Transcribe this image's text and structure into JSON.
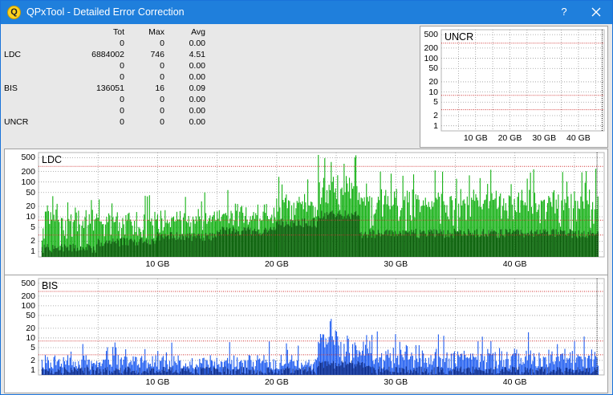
{
  "window": {
    "title": "QPxTool - Detailed Error Correction",
    "app_icon_letter": "Q",
    "help_label": "?",
    "close_icon": "close-icon"
  },
  "stats": {
    "headers": [
      "",
      "Tot",
      "Max",
      "Avg"
    ],
    "rows": [
      {
        "label": "",
        "tot": "0",
        "max": "0",
        "avg": "0.00"
      },
      {
        "label": "LDC",
        "tot": "6884002",
        "max": "746",
        "avg": "4.51"
      },
      {
        "label": "",
        "tot": "0",
        "max": "0",
        "avg": "0.00"
      },
      {
        "label": "",
        "tot": "0",
        "max": "0",
        "avg": "0.00"
      },
      {
        "label": "BIS",
        "tot": "136051",
        "max": "16",
        "avg": "0.09"
      },
      {
        "label": "",
        "tot": "0",
        "max": "0",
        "avg": "0.00"
      },
      {
        "label": "",
        "tot": "0",
        "max": "0",
        "avg": "0.00"
      },
      {
        "label": "UNCR",
        "tot": "0",
        "max": "0",
        "avg": "0.00"
      }
    ]
  },
  "colors": {
    "ldc_bar": "#12b012",
    "ldc_avg": "#0a5a0a",
    "bis_bar": "#1e5cf0",
    "bis_avg": "#0a2a8a",
    "threshold_line": "#d03030",
    "grid": "#9a9a9a"
  },
  "chart_data": [
    {
      "type": "bar",
      "title": "UNCR",
      "y_scale": "log",
      "y_ticks": [
        "500",
        "200",
        "100",
        "50",
        "20",
        "10",
        "5",
        "2",
        "1"
      ],
      "x_ticks": [
        "10 GB",
        "20 GB",
        "30 GB",
        "40 GB"
      ],
      "x_unit": "GB",
      "x_range": [
        0,
        47.5
      ],
      "values_summary": {
        "total": 0,
        "max": 0,
        "avg": 0.0
      },
      "threshold_lines": [
        280,
        8,
        3
      ],
      "end_marker_gb": 46.9
    },
    {
      "type": "bar",
      "title": "LDC",
      "y_scale": "log",
      "y_ticks": [
        "500",
        "200",
        "100",
        "50",
        "20",
        "10",
        "5",
        "2",
        "1"
      ],
      "x_ticks": [
        "10 GB",
        "20 GB",
        "30 GB",
        "40 GB"
      ],
      "x_unit": "GB",
      "x_range": [
        0,
        47.5
      ],
      "values_summary": {
        "total": 6884002,
        "max": 746,
        "avg": 4.51
      },
      "threshold_lines": [
        280,
        8,
        3
      ],
      "end_marker_gb": 46.9,
      "segments": [
        {
          "x_start": 0.3,
          "x_end": 5.0,
          "peak_typical": 15,
          "avg": 1.3
        },
        {
          "x_start": 5.0,
          "x_end": 10.0,
          "peak_typical": 12,
          "avg": 2.0
        },
        {
          "x_start": 10.0,
          "x_end": 15.0,
          "peak_typical": 14,
          "avg": 2.8
        },
        {
          "x_start": 15.0,
          "x_end": 20.0,
          "peak_typical": 20,
          "avg": 4.0
        },
        {
          "x_start": 20.0,
          "x_end": 23.5,
          "peak_typical": 40,
          "avg": 7.0
        },
        {
          "x_start": 23.5,
          "x_end": 27.0,
          "peak_typical": 150,
          "avg": 12.0
        },
        {
          "x_start": 27.0,
          "x_end": 47.0,
          "peak_typical": 60,
          "avg": 3.5
        }
      ]
    },
    {
      "type": "bar",
      "title": "BIS",
      "y_scale": "log",
      "y_ticks": [
        "500",
        "200",
        "100",
        "50",
        "20",
        "10",
        "5",
        "2",
        "1"
      ],
      "x_ticks": [
        "10 GB",
        "20 GB",
        "30 GB",
        "40 GB"
      ],
      "x_unit": "GB",
      "x_range": [
        0,
        47.5
      ],
      "values_summary": {
        "total": 136051,
        "max": 16,
        "avg": 0.09
      },
      "threshold_lines": [
        280,
        8,
        3
      ],
      "end_marker_gb": 46.9,
      "segments": [
        {
          "x_start": 0.3,
          "x_end": 23.5,
          "peak_typical": 2,
          "avg": 1
        },
        {
          "x_start": 23.5,
          "x_end": 28.0,
          "peak_typical": 12,
          "avg": 1.5
        },
        {
          "x_start": 28.0,
          "x_end": 47.0,
          "peak_typical": 4,
          "avg": 1
        }
      ]
    }
  ]
}
